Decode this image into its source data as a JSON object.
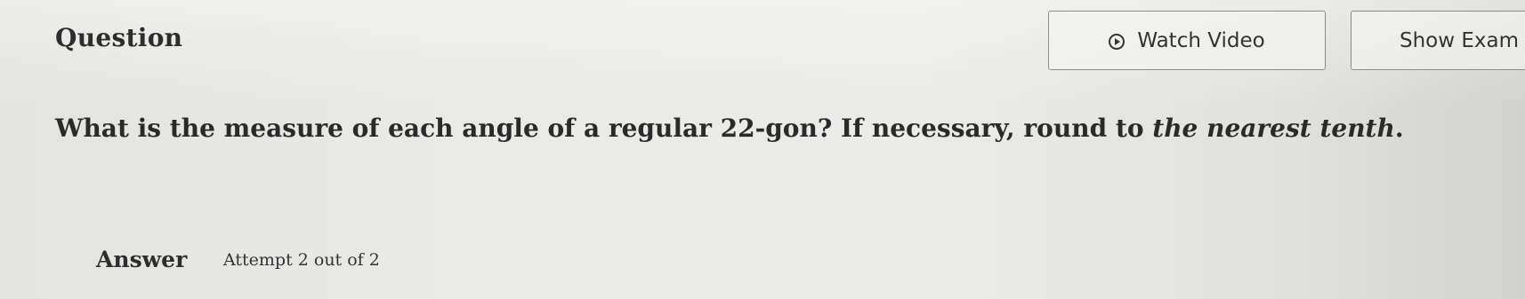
{
  "header": {
    "title": "Question",
    "watch_video_label": "Watch Video",
    "watch_video_icon": "play-circle-icon",
    "show_example_label": "Show Exam"
  },
  "question": {
    "text_main": "What is the measure of each angle of a regular 22-gon? If necessary, round to ",
    "text_italic": "the nearest tenth",
    "text_end": "."
  },
  "answer": {
    "label": "Answer",
    "attempt": "Attempt 2 out of 2"
  }
}
